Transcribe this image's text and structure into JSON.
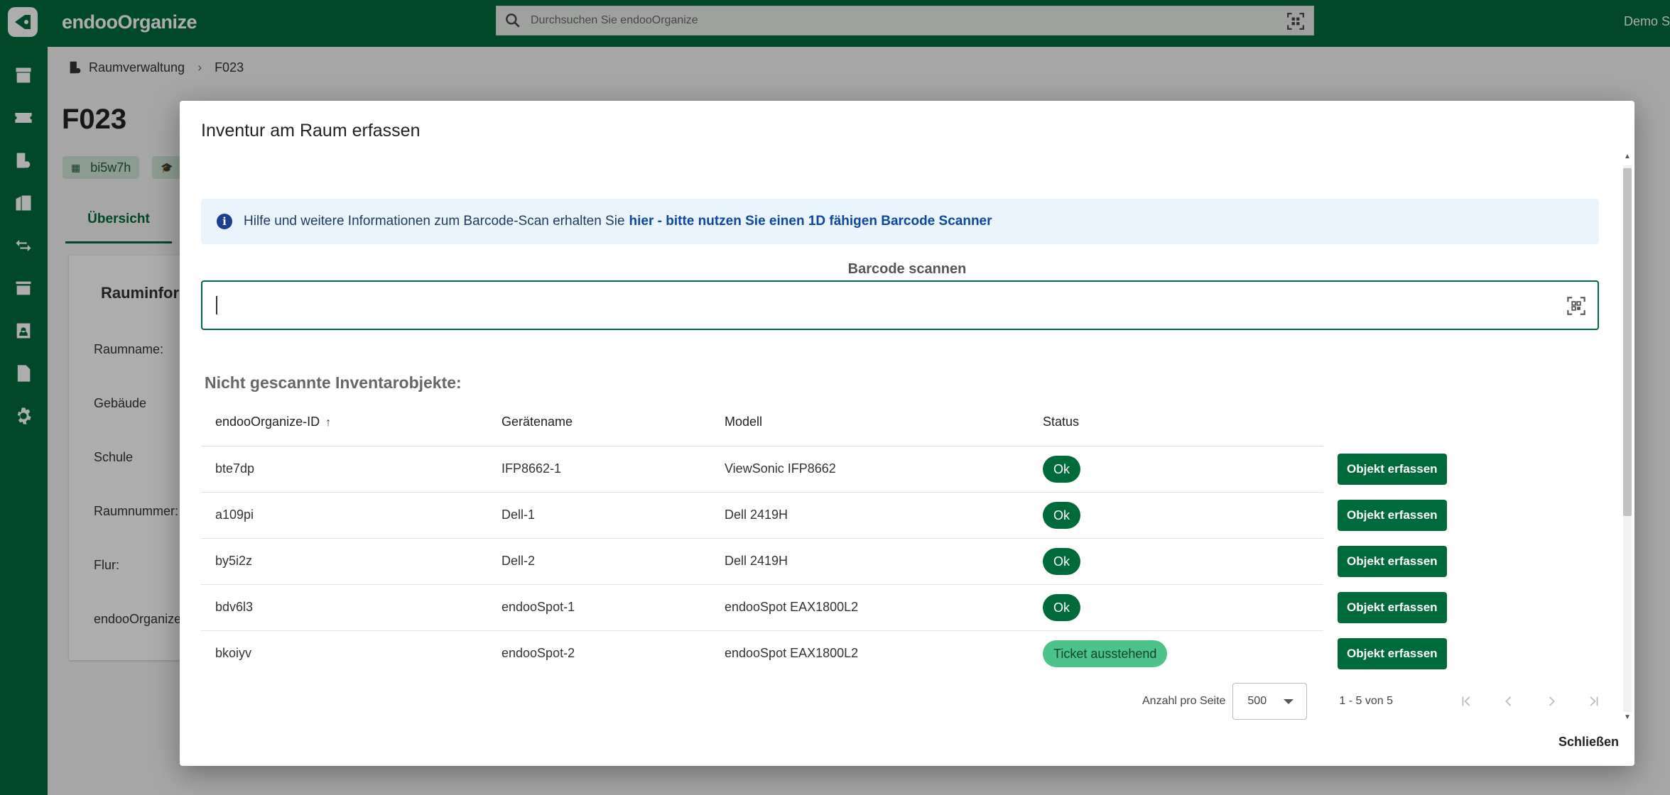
{
  "app": {
    "brand": "endooOrganize",
    "user": "Demo S",
    "search_placeholder": "Durchsuchen Sie endooOrganize"
  },
  "sidebar": {
    "icons": [
      "archive-icon",
      "ticket-icon",
      "room-settings-icon",
      "building-icon",
      "transfer-icon",
      "store-icon",
      "contact-icon",
      "document-icon",
      "settings-icon"
    ]
  },
  "page": {
    "breadcrumb": [
      "Raumverwaltung",
      "F023"
    ],
    "title": "F023",
    "chip": "bi5w7h",
    "tab": "Übersicht",
    "card_title": "Rauminfor",
    "rows": [
      "Raumname:",
      "Gebäude",
      "Schule",
      "Raumnummer:",
      "Flur:",
      "endooOrganize-"
    ]
  },
  "dialog": {
    "title": "Inventur am Raum erfassen",
    "info_text": "Hilfe und weitere Informationen zum Barcode-Scan erhalten Sie",
    "info_link": "hier - bitte nutzen Sie einen 1D fähigen Barcode Scanner",
    "barcode_label": "Barcode scannen",
    "barcode_value": "",
    "section_title": "Nicht gescannte Inventarobjekte:",
    "columns": [
      "endooOrganize-ID",
      "Gerätename",
      "Modell",
      "Status"
    ],
    "rows": [
      {
        "id": "bte7dp",
        "name": "IFP8662-1",
        "model": "ViewSonic IFP8662",
        "status": "Ok",
        "status_type": "ok",
        "action": "Objekt erfassen"
      },
      {
        "id": "a109pi",
        "name": "Dell-1",
        "model": "Dell 2419H",
        "status": "Ok",
        "status_type": "ok",
        "action": "Objekt erfassen"
      },
      {
        "id": "by5i2z",
        "name": "Dell-2",
        "model": "Dell 2419H",
        "status": "Ok",
        "status_type": "ok",
        "action": "Objekt erfassen"
      },
      {
        "id": "bdv6l3",
        "name": "endooSpot-1",
        "model": "endooSpot EAX1800L2",
        "status": "Ok",
        "status_type": "ok",
        "action": "Objekt erfassen"
      },
      {
        "id": "bkoiyv",
        "name": "endooSpot-2",
        "model": "endooSpot EAX1800L2",
        "status": "Ticket ausstehend",
        "status_type": "pending",
        "action": "Objekt erfassen"
      }
    ],
    "pager": {
      "per_page_label": "Anzahl pro Seite",
      "per_page_value": "500",
      "range": "1 - 5 von 5"
    },
    "close_label": "Schließen"
  },
  "colors": {
    "primary": "#006b3a",
    "pending": "#4cc38a",
    "info_bg": "#eaf4fd"
  }
}
